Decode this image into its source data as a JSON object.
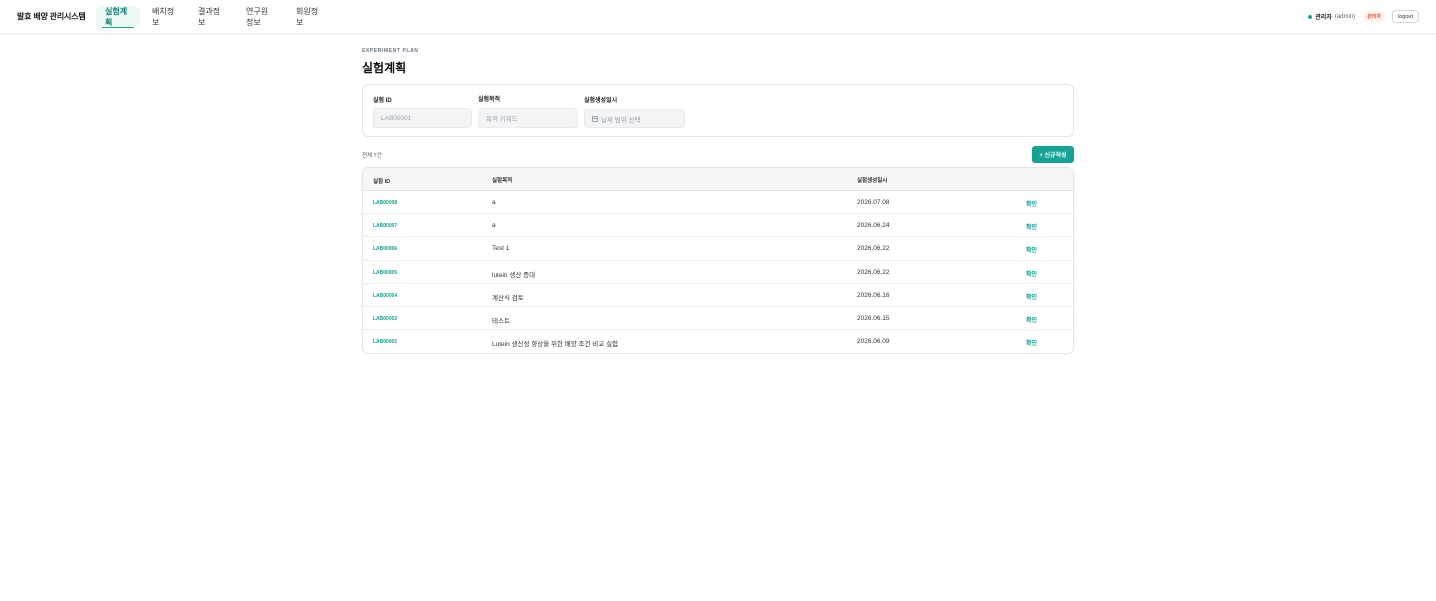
{
  "header": {
    "brand": "발효 배양 관리시스템",
    "nav": [
      {
        "label": "실험계획",
        "active": true
      },
      {
        "label": "배치정보",
        "active": false
      },
      {
        "label": "결과정보",
        "active": false
      },
      {
        "label": "연구원정보",
        "active": false
      },
      {
        "label": "회원정보",
        "active": false
      }
    ],
    "user": {
      "name": "관리자",
      "id": "(admin)",
      "role": "관리자",
      "logout_label": "logout"
    }
  },
  "page": {
    "eyebrow": "EXPERIMENT PLAN",
    "title": "실험계획"
  },
  "filters": {
    "id_label": "실험 ID",
    "id_placeholder": "LAB00001",
    "purpose_label": "실험목적",
    "purpose_placeholder": "목적 키워드",
    "date_label": "실험생성일시",
    "date_placeholder": "날짜 범위 선택"
  },
  "list": {
    "total": "전체 7건",
    "new_button": "+ 신규작성"
  },
  "table": {
    "columns": [
      "실험 ID",
      "실험목적",
      "실험생성일시",
      ""
    ],
    "rows": [
      {
        "id": "LAB00008",
        "purpose": "a",
        "date": "2026.07.08",
        "action": "확인"
      },
      {
        "id": "LAB00007",
        "purpose": "a",
        "date": "2026.06.24",
        "action": "확인"
      },
      {
        "id": "LAB00006",
        "purpose": "Test 1",
        "date": "2026.06.22",
        "action": "확인"
      },
      {
        "id": "LAB00005",
        "purpose": "lutein 생산 증대",
        "date": "2026.06.22",
        "action": "확인"
      },
      {
        "id": "LAB00004",
        "purpose": "계산식 검토",
        "date": "2026.06.16",
        "action": "확인"
      },
      {
        "id": "LAB00002",
        "purpose": "테스트",
        "date": "2026.06.15",
        "action": "확인"
      },
      {
        "id": "LAB00001",
        "purpose": "Lutein 생산성 향상을 위한 배양 조건 비교 실험",
        "date": "2026.06.09",
        "action": "확인"
      }
    ]
  },
  "colors": {
    "accent": "#16a394",
    "accent_text": "#15a191",
    "role_badge": "#e04e3a"
  }
}
